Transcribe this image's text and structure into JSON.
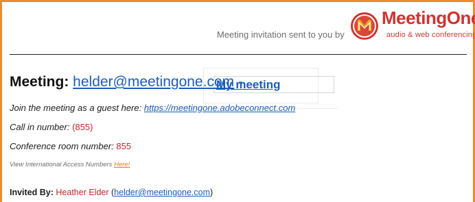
{
  "header": {
    "sent_text": "Meeting invitation sent to you by",
    "logo_name": "MeetingOne",
    "logo_tagline": "audio & web conferencing"
  },
  "meeting": {
    "label": "Meeting:",
    "email": "helder@meetingone.com",
    "separator": "-",
    "name": "My meeting"
  },
  "join": {
    "label": "Join the meeting as a guest here:",
    "url": "https://meetingone.adobeconnect.com"
  },
  "call_in": {
    "label": "Call in number:",
    "value": "(855)"
  },
  "conference": {
    "label": "Conference room number:",
    "value": "855"
  },
  "international": {
    "text": "View International Access Numbers",
    "link": "Here!"
  },
  "invited": {
    "label": "Invited By:",
    "name": "Heather Elder",
    "open": "(",
    "email": "helder@meetingone.com",
    "close": ")"
  },
  "colors": {
    "frame": "#f0892b",
    "brand_red": "#cf3331",
    "link_blue": "#1a5cb8"
  }
}
